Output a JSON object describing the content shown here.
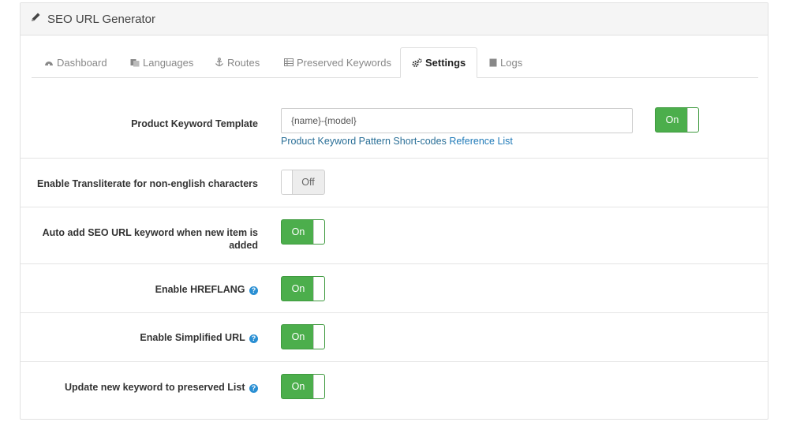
{
  "header": {
    "title": "SEO URL Generator",
    "icon": "pencil-icon"
  },
  "tabs": [
    {
      "label": "Dashboard",
      "icon": "dashboard-icon",
      "active": false
    },
    {
      "label": "Languages",
      "icon": "language-icon",
      "active": false
    },
    {
      "label": "Routes",
      "icon": "anchor-icon",
      "active": false
    },
    {
      "label": "Preserved Keywords",
      "icon": "table-icon",
      "active": false
    },
    {
      "label": "Settings",
      "icon": "cogs-icon",
      "active": true
    },
    {
      "label": "Logs",
      "icon": "file-icon",
      "active": false
    }
  ],
  "settings": {
    "product_keyword": {
      "label": "Product Keyword Template",
      "value": "{name}-{model}",
      "help_text": "Product Keyword Pattern Short-codes",
      "help_link": "Reference List",
      "toggle": "On"
    },
    "transliterate": {
      "label": "Enable Transliterate for non-english characters",
      "toggle": "Off"
    },
    "auto_add": {
      "label": "Auto add SEO URL keyword when new item is added",
      "toggle": "On"
    },
    "hreflang": {
      "label": "Enable HREFLANG",
      "toggle": "On"
    },
    "simplified_url": {
      "label": "Enable Simplified URL",
      "toggle": "On"
    },
    "update_preserved": {
      "label": "Update new keyword to preserved List",
      "toggle": "On"
    }
  },
  "colors": {
    "on": "#4cae4c",
    "link": "#1f7ab8",
    "help_badge": "#2a8fd3"
  }
}
